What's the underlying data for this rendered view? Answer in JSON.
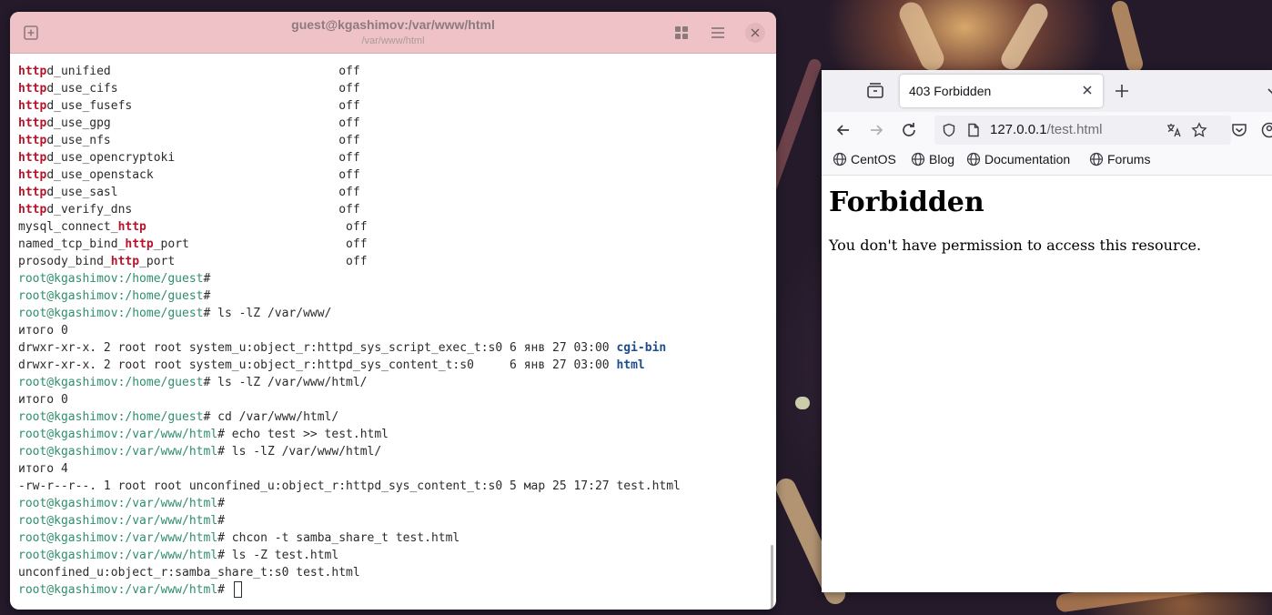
{
  "terminal": {
    "title": "guest@kgashimov:/var/www/html",
    "subtitle": "/var/www/html",
    "lines": [
      [
        {
          "t": "http",
          "c": "hl"
        },
        {
          "t": "d_unified                                off"
        }
      ],
      [
        {
          "t": "http",
          "c": "hl"
        },
        {
          "t": "d_use_cifs                               off"
        }
      ],
      [
        {
          "t": "http",
          "c": "hl"
        },
        {
          "t": "d_use_fusefs                             off"
        }
      ],
      [
        {
          "t": "http",
          "c": "hl"
        },
        {
          "t": "d_use_gpg                                off"
        }
      ],
      [
        {
          "t": "http",
          "c": "hl"
        },
        {
          "t": "d_use_nfs                                off"
        }
      ],
      [
        {
          "t": "http",
          "c": "hl"
        },
        {
          "t": "d_use_opencryptoki                       off"
        }
      ],
      [
        {
          "t": "http",
          "c": "hl"
        },
        {
          "t": "d_use_openstack                          off"
        }
      ],
      [
        {
          "t": "http",
          "c": "hl"
        },
        {
          "t": "d_use_sasl                               off"
        }
      ],
      [
        {
          "t": "http",
          "c": "hl"
        },
        {
          "t": "d_verify_dns                             off"
        }
      ],
      [
        {
          "t": "mysql_connect_"
        },
        {
          "t": "http",
          "c": "hl"
        },
        {
          "t": "                            off"
        }
      ],
      [
        {
          "t": "named_tcp_bind_"
        },
        {
          "t": "http",
          "c": "hl"
        },
        {
          "t": "_port                      off"
        }
      ],
      [
        {
          "t": "prosody_bind_"
        },
        {
          "t": "http",
          "c": "hl"
        },
        {
          "t": "_port                        off"
        }
      ],
      [
        {
          "t": "root@kgashimov:/home/guest",
          "c": "prompt"
        },
        {
          "t": "#"
        }
      ],
      [
        {
          "t": "root@kgashimov:/home/guest",
          "c": "prompt"
        },
        {
          "t": "#"
        }
      ],
      [
        {
          "t": "root@kgashimov:/home/guest",
          "c": "prompt"
        },
        {
          "t": "# ls -lZ /var/www/"
        }
      ],
      [
        {
          "t": "итого 0"
        }
      ],
      [
        {
          "t": "drwxr-xr-x. 2 root root system_u:object_r:httpd_sys_script_exec_t:s0 6 янв 27 03:00 "
        },
        {
          "t": "cgi-bin",
          "c": "dir"
        }
      ],
      [
        {
          "t": "drwxr-xr-x. 2 root root system_u:object_r:httpd_sys_content_t:s0     6 янв 27 03:00 "
        },
        {
          "t": "html",
          "c": "dir"
        }
      ],
      [
        {
          "t": "root@kgashimov:/home/guest",
          "c": "prompt"
        },
        {
          "t": "# ls -lZ /var/www/html/"
        }
      ],
      [
        {
          "t": "итого 0"
        }
      ],
      [
        {
          "t": "root@kgashimov:/home/guest",
          "c": "prompt"
        },
        {
          "t": "# cd /var/www/html/"
        }
      ],
      [
        {
          "t": "root@kgashimov:/var/www/html",
          "c": "prompt"
        },
        {
          "t": "# echo test >> test.html"
        }
      ],
      [
        {
          "t": "root@kgashimov:/var/www/html",
          "c": "prompt"
        },
        {
          "t": "# ls -lZ /var/www/html/"
        }
      ],
      [
        {
          "t": "итого 4"
        }
      ],
      [
        {
          "t": "-rw-r--r--. 1 root root unconfined_u:object_r:httpd_sys_content_t:s0 5 мар 25 17:27 test.html"
        }
      ],
      [
        {
          "t": "root@kgashimov:/var/www/html",
          "c": "prompt"
        },
        {
          "t": "#"
        }
      ],
      [
        {
          "t": "root@kgashimov:/var/www/html",
          "c": "prompt"
        },
        {
          "t": "#"
        }
      ],
      [
        {
          "t": "root@kgashimov:/var/www/html",
          "c": "prompt"
        },
        {
          "t": "# chcon -t samba_share_t test.html"
        }
      ],
      [
        {
          "t": "root@kgashimov:/var/www/html",
          "c": "prompt"
        },
        {
          "t": "# ls -Z test.html"
        }
      ],
      [
        {
          "t": "unconfined_u:object_r:samba_share_t:s0 test.html"
        }
      ],
      [
        {
          "t": "root@kgashimov:/var/www/html",
          "c": "prompt"
        },
        {
          "t": "# "
        }
      ]
    ],
    "icons": {
      "new_tab": "new-tab-icon",
      "view": "grid-icon",
      "menu": "hamburger-menu-icon",
      "close": "close-icon"
    }
  },
  "browser": {
    "tab_title": "403 Forbidden",
    "url_host": "127.0.0.1",
    "url_path": "/test.html",
    "bookmarks": [
      "CentOS",
      "Blog",
      "Documentation",
      "Forums"
    ],
    "page": {
      "heading": "Forbidden",
      "message": "You don't have permission to access this resource."
    }
  },
  "colors": {
    "terminal_header": "#efc2c7",
    "prompt": "#2f8f6a",
    "highlight": "#b5152b",
    "directory": "#1e4d8c"
  }
}
